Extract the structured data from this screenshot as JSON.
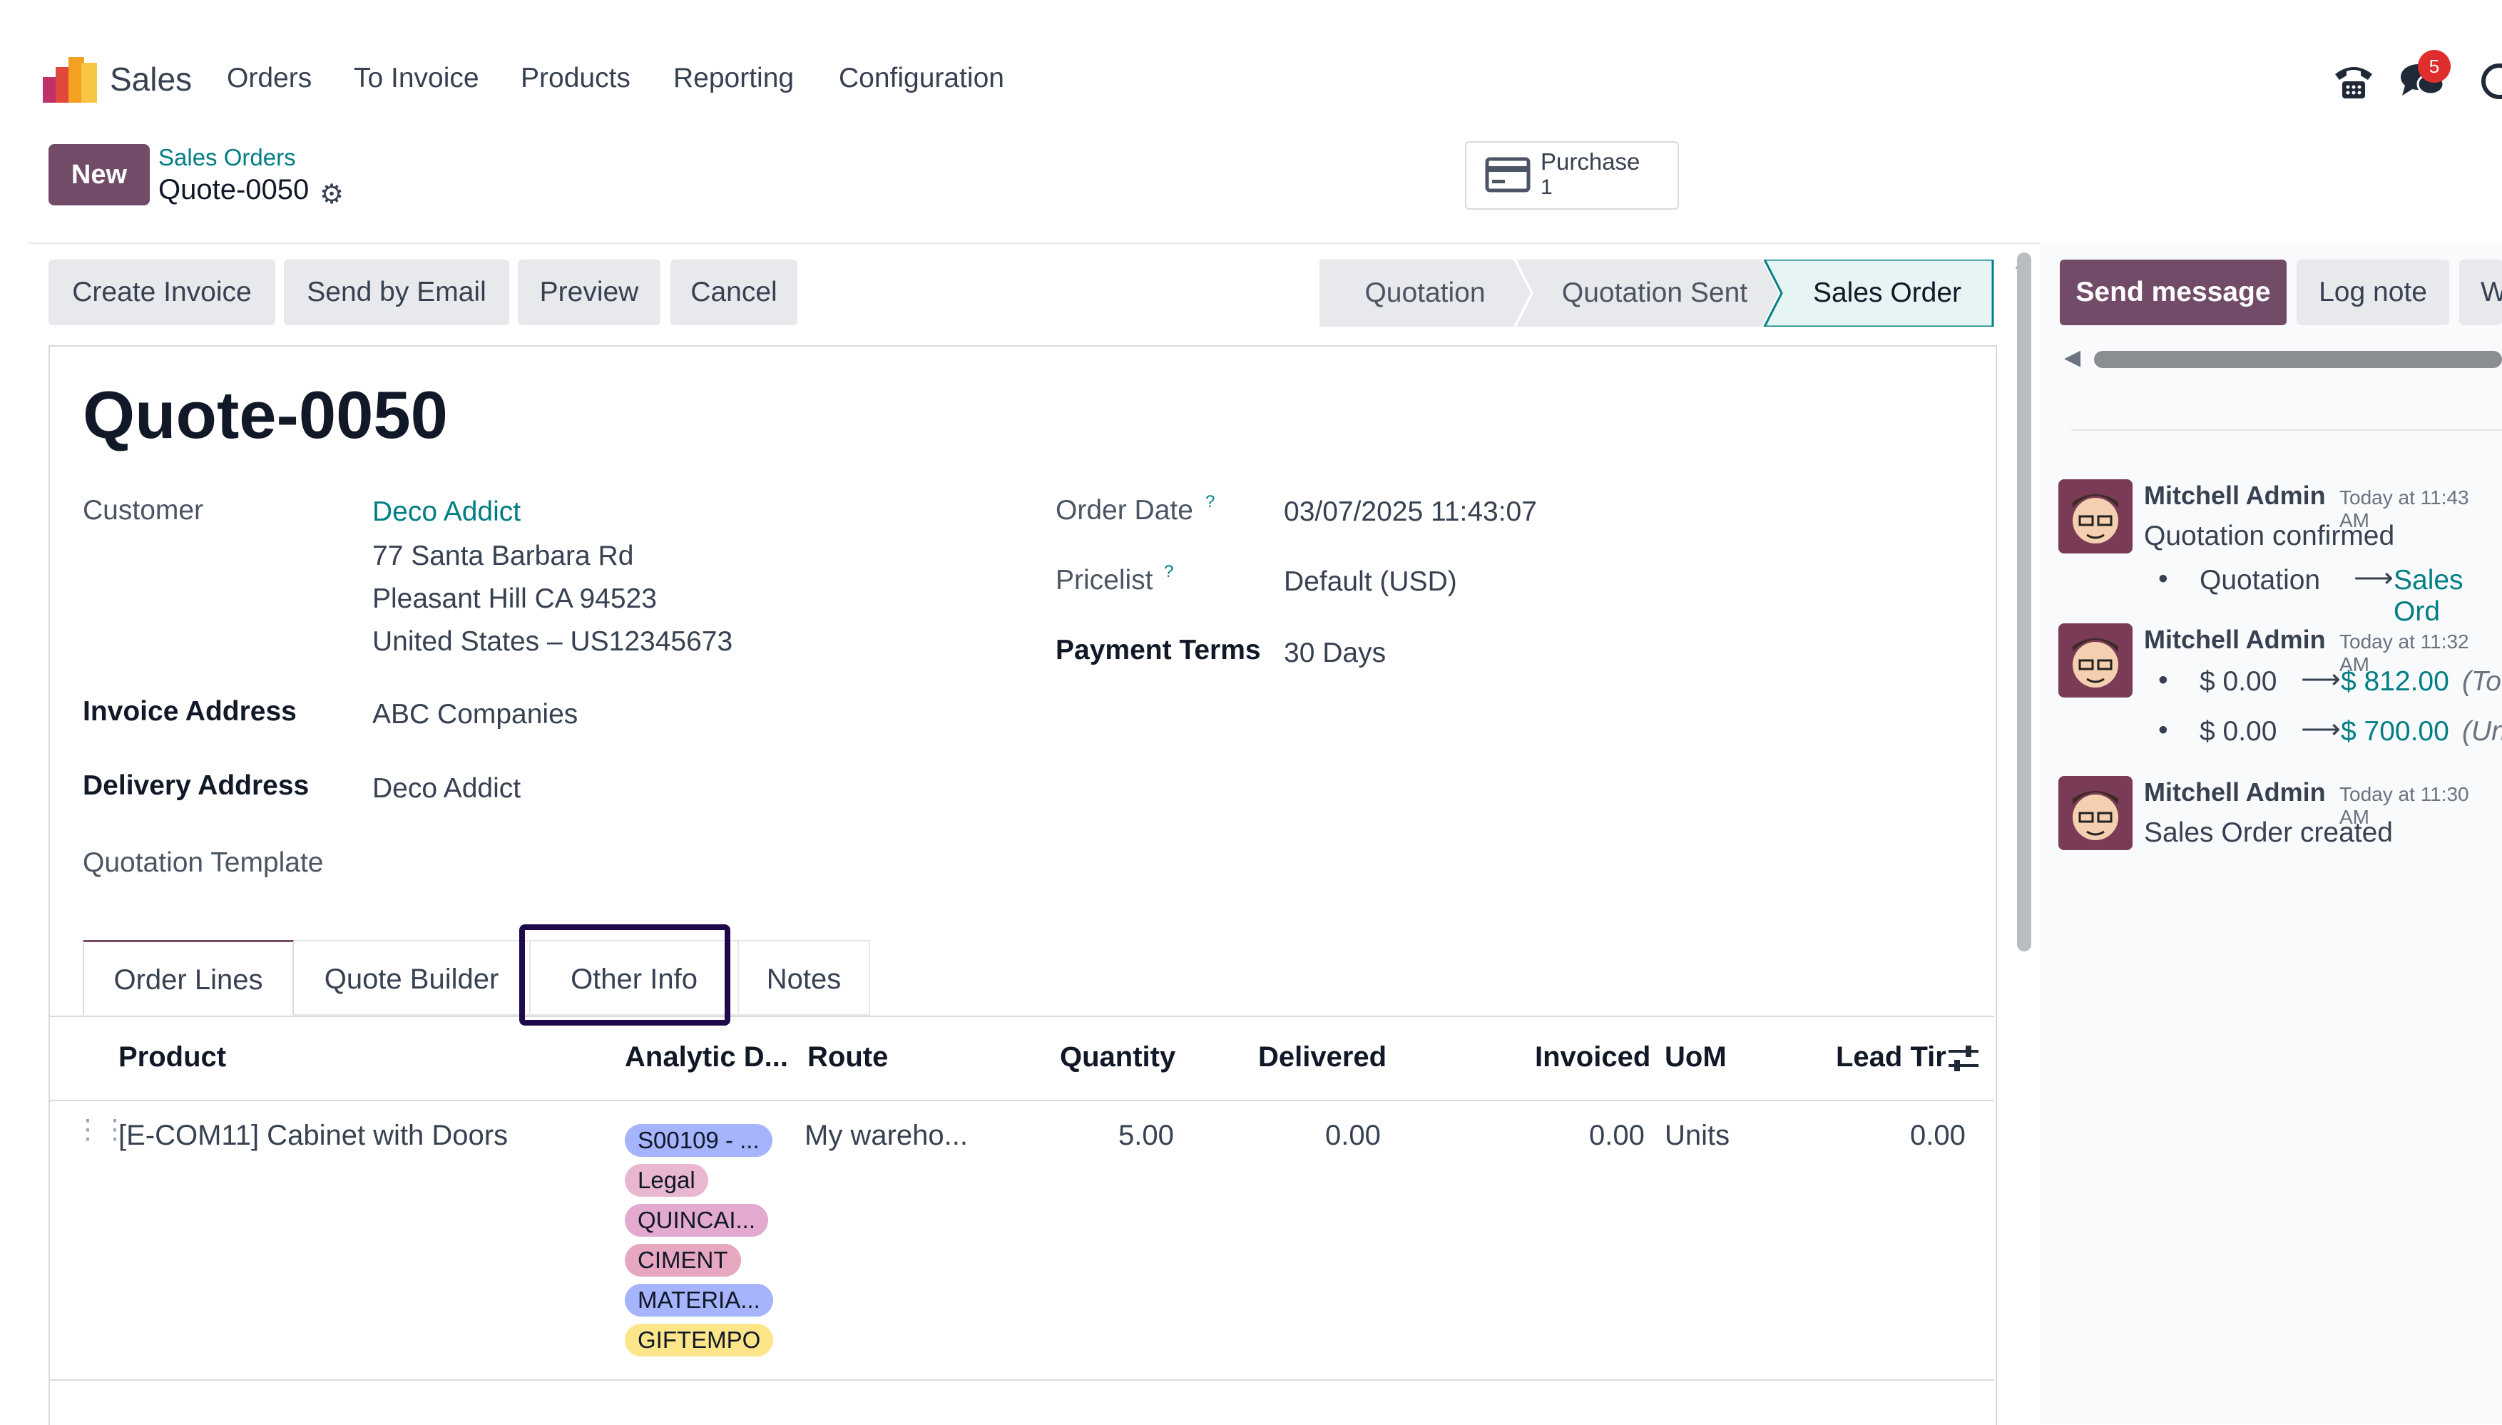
{
  "nav": {
    "app_name": "Sales",
    "items": [
      "Orders",
      "To Invoice",
      "Products",
      "Reporting",
      "Configuration"
    ],
    "notification_count": "5"
  },
  "control": {
    "new_label": "New",
    "breadcrumb_parent": "Sales Orders",
    "breadcrumb_current": "Quote-0050",
    "smart_button": {
      "label": "Purchase",
      "value": "1"
    }
  },
  "actions": [
    "Create Invoice",
    "Send by Email",
    "Preview",
    "Cancel"
  ],
  "status": {
    "stages": [
      "Quotation",
      "Quotation Sent",
      "Sales Order"
    ],
    "active": "Sales Order"
  },
  "form": {
    "title": "Quote-0050",
    "customer_label": "Customer",
    "customer_name": "Deco Addict",
    "customer_address": [
      "77 Santa Barbara Rd",
      "Pleasant Hill CA 94523",
      "United States – US12345673"
    ],
    "invoice_address_label": "Invoice Address",
    "invoice_address": "ABC Companies",
    "delivery_address_label": "Delivery Address",
    "delivery_address": "Deco Addict",
    "template_label": "Quotation Template",
    "order_date_label": "Order Date",
    "order_date": "03/07/2025 11:43:07",
    "pricelist_label": "Pricelist",
    "pricelist": "Default (USD)",
    "payment_terms_label": "Payment Terms",
    "payment_terms": "30 Days",
    "help_mark": "?"
  },
  "tabs": [
    "Order Lines",
    "Quote Builder",
    "Other Info",
    "Notes"
  ],
  "table": {
    "headers": [
      "Product",
      "Analytic D...",
      "Route",
      "Quantity",
      "Delivered",
      "Invoiced",
      "UoM",
      "Lead Tir"
    ],
    "row": {
      "product": "[E-COM11] Cabinet with Doors",
      "tags": [
        "S00109 - ...",
        "Legal",
        "QUINCAI...",
        "CIMENT",
        "MATERIA...",
        "GIFTEMPO"
      ],
      "route": "My wareho...",
      "quantity": "5.00",
      "delivered": "0.00",
      "invoiced": "0.00",
      "uom": "Units",
      "lead_time": "0.00"
    },
    "tag_colors": [
      "#a5b4fc",
      "#e9b8d0",
      "#e3a9cf",
      "#e7a7c1",
      "#a5b4fc",
      "#fde68a"
    ]
  },
  "chatter": {
    "send_message": "Send message",
    "log_note": "Log note",
    "third_btn": "W",
    "messages": [
      {
        "author": "Mitchell Admin",
        "time": "Today at 11:43 AM",
        "body": "Quotation confirmed",
        "change_from": "Quotation",
        "change_to": "Sales Ord"
      },
      {
        "author": "Mitchell Admin",
        "time": "Today at 11:32 AM",
        "lines": [
          {
            "from": "$ 0.00",
            "to": "$ 812.00",
            "field": "(Tot"
          },
          {
            "from": "$ 0.00",
            "to": "$ 700.00",
            "field": "(Un"
          }
        ]
      },
      {
        "author": "Mitchell Admin",
        "time": "Today at 11:30 AM",
        "body": "Sales Order created"
      }
    ]
  },
  "colors": {
    "brand": "#714b67",
    "link": "#017e84",
    "highlight": "#1e0a4a",
    "badge": "#e02d2d"
  }
}
